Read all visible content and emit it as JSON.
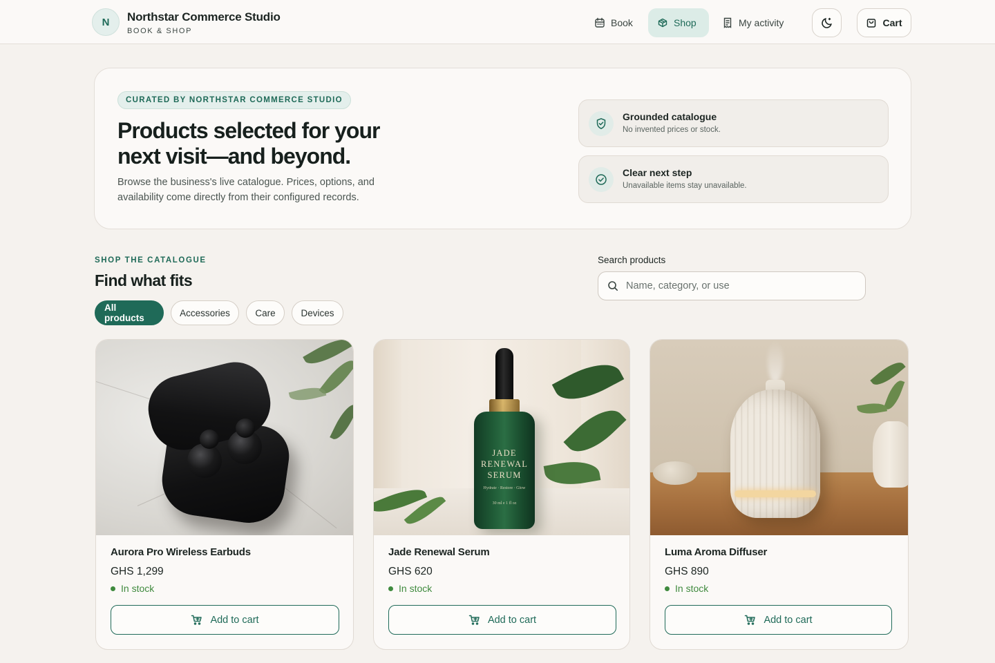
{
  "brand": {
    "initial": "N",
    "name": "Northstar Commerce Studio",
    "tagline": "BOOK & SHOP"
  },
  "nav": {
    "items": [
      {
        "label": "Book",
        "icon": "calendar-icon",
        "active": false
      },
      {
        "label": "Shop",
        "icon": "shopping-bag-icon",
        "active": true
      },
      {
        "label": "My activity",
        "icon": "receipt-icon",
        "active": false
      }
    ],
    "theme_icon": "moon-icon",
    "cart_label": "Cart"
  },
  "hero": {
    "badge": "CURATED BY NORTHSTAR COMMERCE STUDIO",
    "title": "Products selected for your next visit—and beyond.",
    "body": "Browse the business's live catalogue. Prices, options, and availability come directly from their configured records.",
    "features": [
      {
        "title": "Grounded catalogue",
        "description": "No invented prices or stock.",
        "icon": "shield-check-icon"
      },
      {
        "title": "Clear next step",
        "description": "Unavailable items stay unavailable.",
        "icon": "check-circle-icon"
      }
    ]
  },
  "catalogue": {
    "eyebrow": "SHOP THE CATALOGUE",
    "title": "Find what fits",
    "search_label": "Search products",
    "search_placeholder": "Name, category, or use",
    "search_value": "",
    "filters": [
      {
        "label": "All products",
        "active": true
      },
      {
        "label": "Accessories",
        "active": false
      },
      {
        "label": "Care",
        "active": false
      },
      {
        "label": "Devices",
        "active": false
      }
    ]
  },
  "products": [
    {
      "name": "Aurora Pro Wireless Earbuds",
      "price": "GHS 1,299",
      "stock": "In stock",
      "button": "Add to cart"
    },
    {
      "name": "Jade Renewal Serum",
      "price": "GHS 620",
      "stock": "In stock",
      "button": "Add to cart",
      "package_text": [
        "JADE",
        "RENEWAL",
        "SERUM",
        "Hydrate · Restore · Glow",
        "30 ml e 1 fl oz"
      ]
    },
    {
      "name": "Luma Aroma Diffuser",
      "price": "GHS 890",
      "stock": "In stock",
      "button": "Add to cart"
    }
  ],
  "colors": {
    "accent": "#1f6a58",
    "accent_soft": "#dcece7",
    "in_stock": "#3f8a3e",
    "background": "#f5f2ee"
  }
}
